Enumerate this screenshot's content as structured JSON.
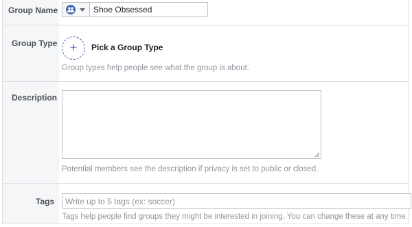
{
  "group_name": {
    "label": "Group Name",
    "value": "Shoe Obsessed",
    "privacy_icon": "group-icon"
  },
  "group_type": {
    "label": "Group Type",
    "pick_text": "Pick a Group Type",
    "help": "Group types help people see what the group is about."
  },
  "description": {
    "label": "Description",
    "value": "",
    "help": "Potential members see the description if privacy is set to public or closed."
  },
  "tags": {
    "label": "Tags",
    "placeholder": "Write up to 5 tags (ex: soccer)",
    "help": "Tags help people find groups they might be interested in joining. You can change these at any time."
  },
  "colors": {
    "accent": "#4267b2",
    "label_bg": "#f5f6f7",
    "border": "#dddfe2",
    "help_text": "#90949c"
  }
}
